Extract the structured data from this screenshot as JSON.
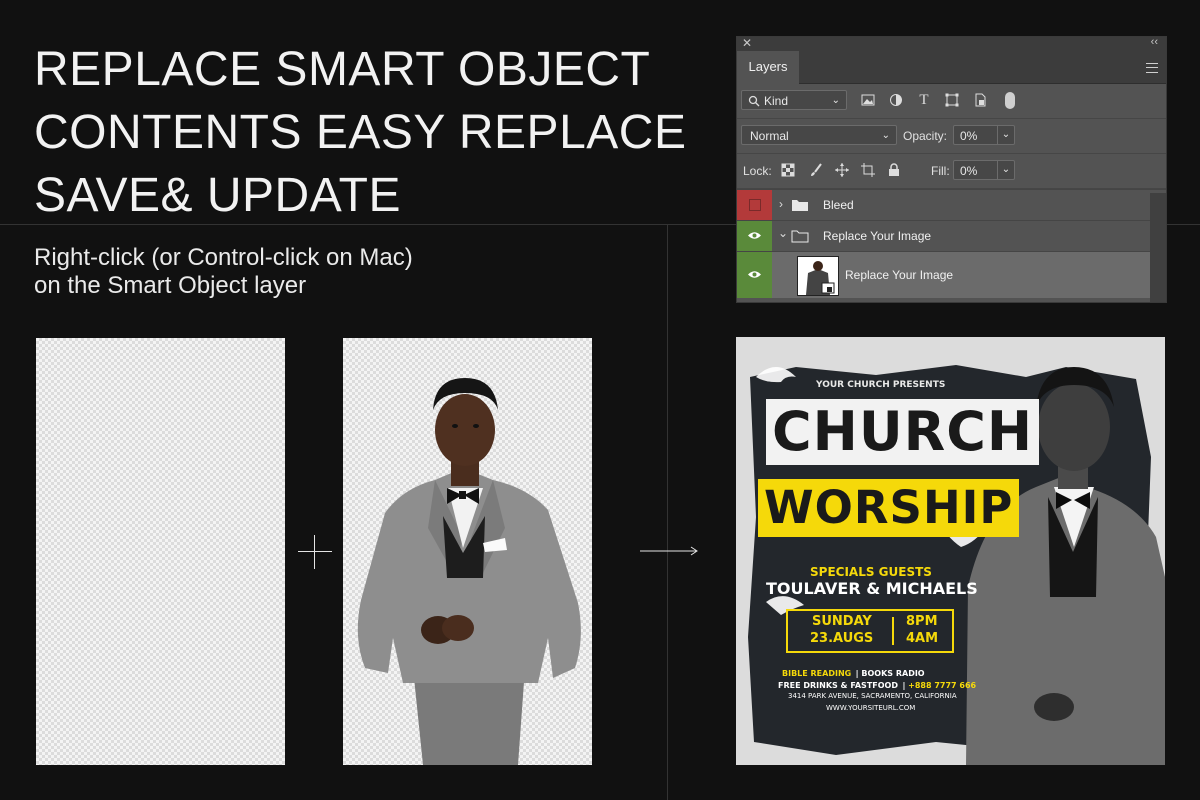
{
  "headline": {
    "line1": "REPLACE SMART OBJECT",
    "line2": "CONTENTS EASY REPLACE",
    "line3": "SAVE& UPDATE"
  },
  "subtitle": {
    "line1": "Right-click (or Control-click on Mac)",
    "line2": "on the Smart Object layer"
  },
  "layers_panel": {
    "tab": "Layers",
    "filter_kind": "Kind",
    "blend_mode": "Normal",
    "opacity_label": "Opacity:",
    "opacity_value": "0%",
    "lock_label": "Lock:",
    "fill_label": "Fill:",
    "fill_value": "0%",
    "layers": [
      {
        "name": "Bleed",
        "type": "group",
        "color": "#b33a3a",
        "visible": false
      },
      {
        "name": "Replace Your Image",
        "type": "group",
        "color": "#5a8a3a",
        "visible": true
      },
      {
        "name": "Replace Your Image",
        "type": "smart-object",
        "color": "#5a8a3a",
        "visible": true
      }
    ]
  },
  "flyer": {
    "presents": "YOUR CHURCH PRESENTS",
    "title1": "CHURCH",
    "title2": "WORSHIP",
    "specials": "SPECIALS GUESTS",
    "guests": "TOULAVER & MICHAELS",
    "day": "SUNDAY",
    "date": "23.AUGS",
    "time1": "8PM",
    "time2": "4AM",
    "info1_a": "BIBLE READING",
    "info1_b": "BOOKS RADIO",
    "info2_a": "FREE DRINKS & FASTFOOD",
    "info2_b": "+888 7777 666",
    "address": "3414 PARK AVENUE, SACRAMENTO, CALIFORNIA",
    "website": "WWW.YOURSITEURL.COM",
    "accent": "#f5d90a"
  },
  "colors": {
    "background": "#111111",
    "panel": "#535353",
    "red_tag": "#b33a3a",
    "green_tag": "#5a8a3a"
  }
}
